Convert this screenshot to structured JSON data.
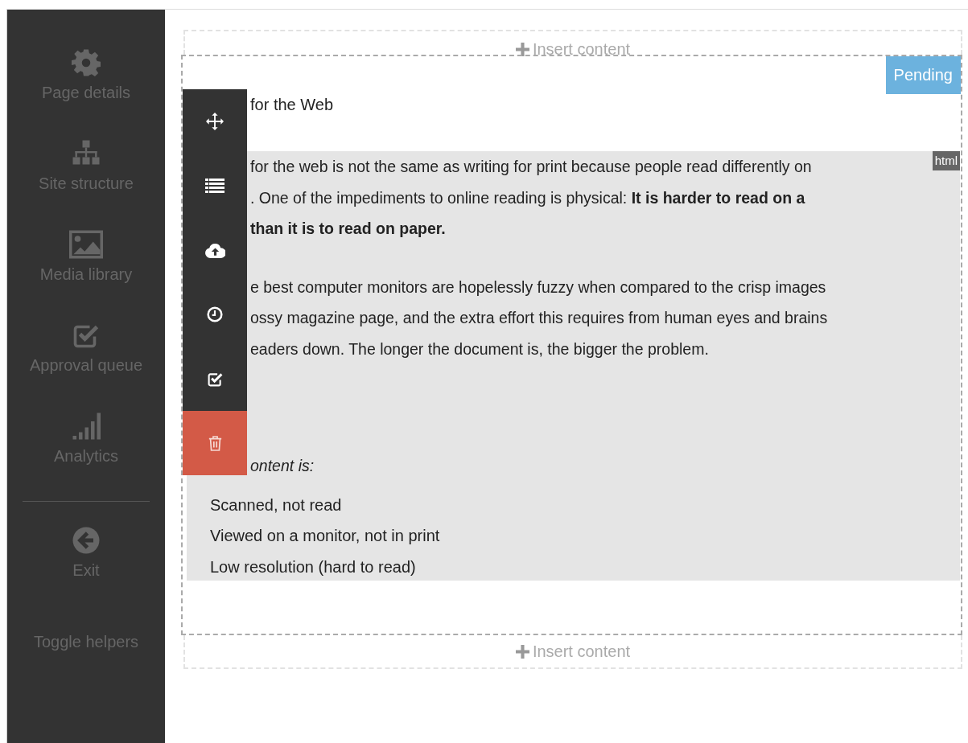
{
  "sidebar": {
    "items": [
      {
        "kind": "gear",
        "label": "Page details"
      },
      {
        "kind": "sitemap",
        "label": "Site structure"
      },
      {
        "kind": "image",
        "label": "Media library"
      },
      {
        "kind": "check",
        "label": "Approval queue"
      },
      {
        "kind": "bars",
        "label": "Analytics"
      }
    ],
    "footer_items": [
      {
        "kind": "exit",
        "label": "Exit"
      },
      {
        "kind": "none",
        "label": "Toggle helpers"
      }
    ]
  },
  "insert_zones": [
    {
      "label": "Insert content"
    },
    {
      "label": "Insert content"
    }
  ],
  "block": {
    "status": "Pending",
    "format_badge": "html",
    "toolbar": [
      {
        "kind": "move"
      },
      {
        "kind": "list"
      },
      {
        "kind": "upload"
      },
      {
        "kind": "clock"
      },
      {
        "kind": "approve"
      },
      {
        "kind": "delete"
      }
    ],
    "heading": "for the Web",
    "paragraphs": [
      {
        "lines": [
          "for the web is not the same as writing for print because people read differently on",
          ". One of the impediments to online reading is physical: **It is harder to read on a**",
          "**than it is to read on paper.**"
        ]
      },
      {
        "lines": [
          "e best computer monitors are hopelessly fuzzy when compared to the crisp images",
          "ossy magazine page, and the extra effort this requires from human eyes and brains",
          "eaders down. The longer the document is, the bigger the problem."
        ]
      }
    ],
    "emphasis": "ontent is:",
    "list": [
      "Scanned, not read",
      "Viewed on a monitor, not in print",
      "Low resolution (hard to read)"
    ]
  }
}
